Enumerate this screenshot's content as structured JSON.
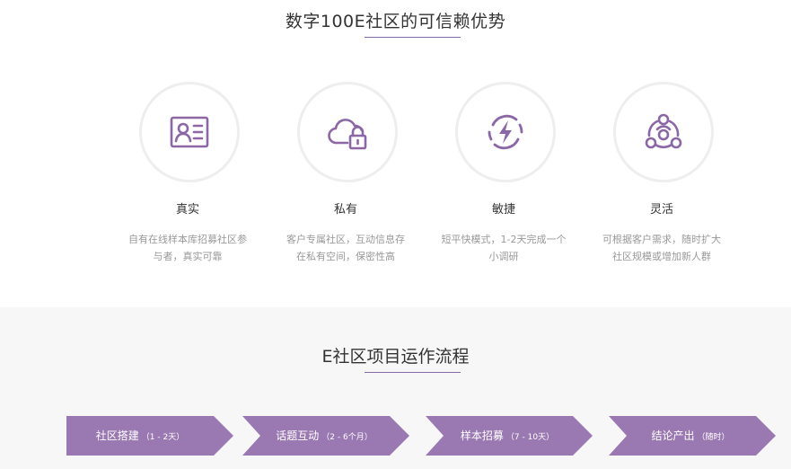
{
  "section1": {
    "title": "数字100E社区的可信赖优势",
    "features": [
      {
        "icon": "id-card-icon",
        "title": "真实",
        "desc_line1": "自有在线样本库招募社区参",
        "desc_line2": "与者，真实可靠"
      },
      {
        "icon": "cloud-lock-icon",
        "title": "私有",
        "desc_line1": "客户专属社区，互动信息存",
        "desc_line2": "在私有空间，保密性高"
      },
      {
        "icon": "lightning-cycle-icon",
        "title": "敏捷",
        "desc_line1": "短平快模式，1-2天完成一个",
        "desc_line2": "小调研"
      },
      {
        "icon": "network-people-icon",
        "title": "灵活",
        "desc_line1": "可根据客户需求，随时扩大",
        "desc_line2": "社区规模或增加新人群"
      }
    ]
  },
  "section2": {
    "title": "E社区项目运作流程",
    "steps": [
      {
        "label": "社区搭建",
        "sub": "（1 - 2天）"
      },
      {
        "label": "话题互动",
        "sub": "（2 - 6个月）"
      },
      {
        "label": "样本招募",
        "sub": "（7 - 10天）"
      },
      {
        "label": "结论产出",
        "sub": "（随时）"
      }
    ]
  },
  "colors": {
    "accent": "#8b67a6",
    "step_fill": "#9a78b1",
    "muted_text": "#999999",
    "title_text": "#333333",
    "band_bg": "#f7f7f7"
  }
}
